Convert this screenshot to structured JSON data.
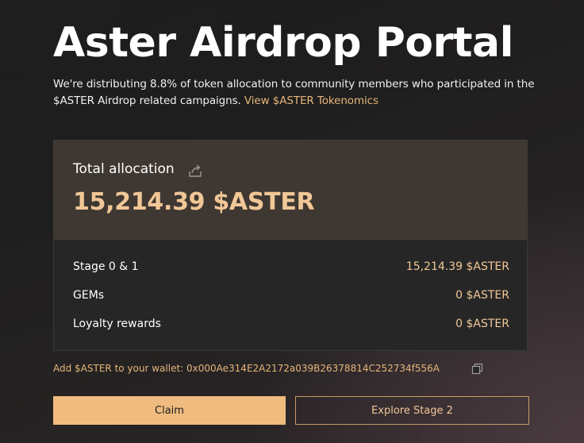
{
  "header": {
    "title": "Aster Airdrop Portal",
    "description": "We're distributing 8.8% of token allocation to community members who participated in the $ASTER Airdrop related campaigns.",
    "tokenomics_link": "View $ASTER Tokenomics"
  },
  "allocation": {
    "label": "Total allocation",
    "value": "15,214.39 $ASTER",
    "share_icon": "share-icon",
    "rows": [
      {
        "label": "Stage 0 & 1",
        "value": "15,214.39 $ASTER"
      },
      {
        "label": "GEMs",
        "value": "0 $ASTER"
      },
      {
        "label": "Loyalty rewards",
        "value": "0 $ASTER"
      }
    ]
  },
  "wallet": {
    "text": "Add $ASTER to your wallet: 0x000Ae314E2A2172a039B26378814C252734f556A",
    "copy_icon": "copy-icon"
  },
  "actions": {
    "claim_label": "Claim",
    "explore_label": "Explore Stage 2"
  },
  "colors": {
    "accent": "#efbb7f",
    "accent_text": "#f1c797",
    "link": "#e4b57a",
    "card_top": "#3f3832",
    "card_body": "#262626"
  }
}
